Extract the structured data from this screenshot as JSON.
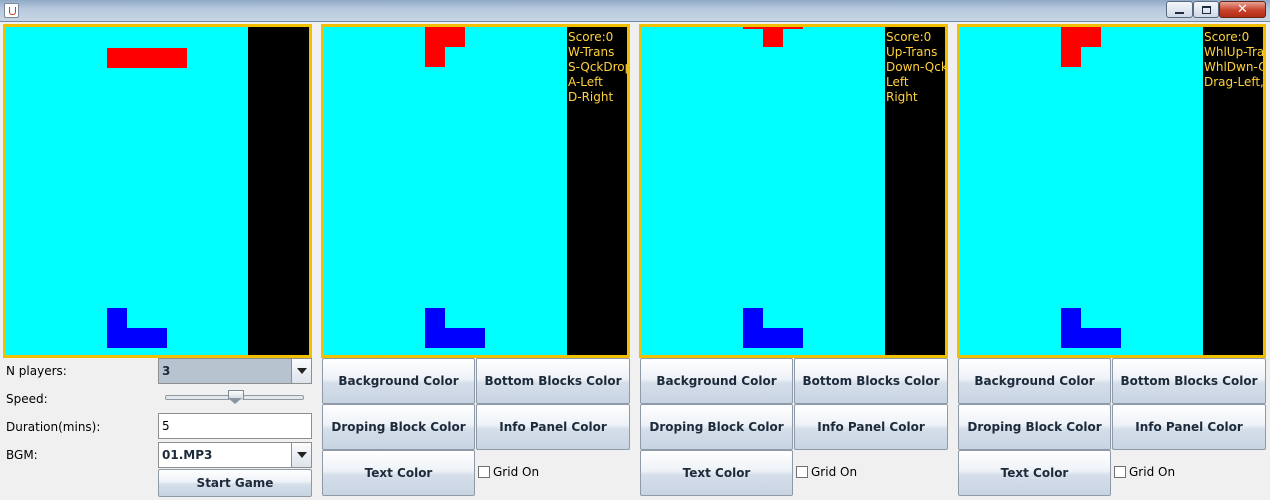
{
  "window": {
    "icon": "java-cup-icon",
    "controls": {
      "minimize": "minimize-icon",
      "maximize": "maximize-icon",
      "close_glyph": "✕"
    }
  },
  "colors": {
    "board_background": "#00ffff",
    "board_border": "#f0c000",
    "info_panel_background": "#000000",
    "info_text": "#ffd23a",
    "dropping_block": "#ff0000",
    "bottom_blocks": "#0000ff"
  },
  "settings": {
    "players_label": "N players:",
    "players_value": "3",
    "speed_label": "Speed:",
    "speed_level": 0.5,
    "duration_label": "Duration(mins):",
    "duration_value": "5",
    "bgm_label": "BGM:",
    "bgm_value": "01.MP3",
    "start_button": "Start Game"
  },
  "players": [
    {
      "info": [
        "Score:0",
        "W-Trans",
        "S-QckDrop",
        "A-Left",
        "D-Right"
      ],
      "background_button": "Background Color",
      "bottom_blocks_button": "Bottom Blocks Color",
      "dropping_block_button": "Droping Block Color",
      "info_panel_button": "Info Panel Color",
      "text_color_button": "Text Color",
      "grid_label": "Grid On",
      "grid_on": false
    },
    {
      "info": [
        "Score:0",
        "Up-Trans",
        "Down-Qck",
        "Left",
        "Right"
      ],
      "background_button": "Background Color",
      "bottom_blocks_button": "Bottom Blocks Color",
      "dropping_block_button": "Droping Block Color",
      "info_panel_button": "Info Panel Color",
      "text_color_button": "Text Color",
      "grid_label": "Grid On",
      "grid_on": false
    },
    {
      "info": [
        "Score:0",
        "WhlUp-Tra",
        "WhlDwn-Q",
        "Drag-Left,R"
      ],
      "background_button": "Background Color",
      "bottom_blocks_button": "Bottom Blocks Color",
      "dropping_block_button": "Droping Block Color",
      "info_panel_button": "Info Panel Color",
      "text_color_button": "Text Color",
      "grid_label": "Grid On",
      "grid_on": false
    }
  ]
}
